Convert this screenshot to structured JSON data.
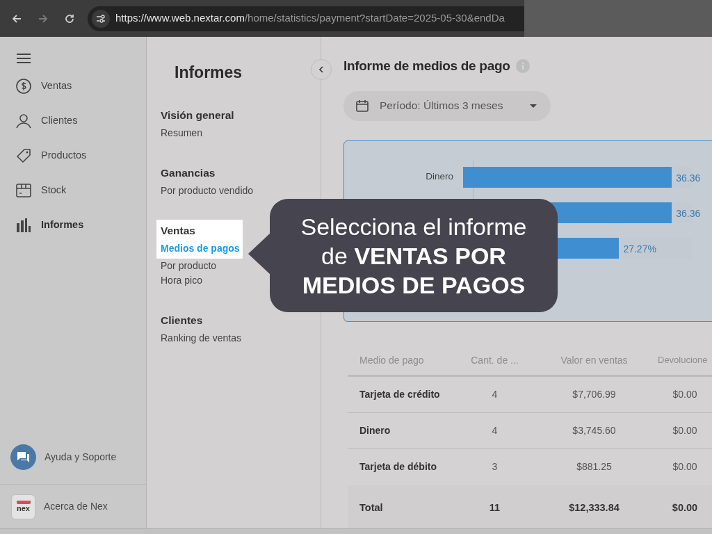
{
  "browser": {
    "url_host": "https://www.web.nextar.com",
    "url_path": "/home/statistics/payment?startDate=2025-05-30&endDa"
  },
  "sidebar": {
    "items": [
      {
        "kind": "dollar",
        "label": "Ventas",
        "selected": false
      },
      {
        "kind": "person",
        "label": "Clientes",
        "selected": false
      },
      {
        "kind": "tag",
        "label": "Productos",
        "selected": false
      },
      {
        "kind": "box",
        "label": "Stock",
        "selected": false
      },
      {
        "kind": "chart",
        "label": "Informes",
        "selected": true
      }
    ],
    "help": "Ayuda y Soporte",
    "about": "Acerca de Nex",
    "logo": "nex"
  },
  "reports_panel": {
    "title": "Informes",
    "sections": [
      {
        "heading": "Visión general",
        "highlighted": false,
        "items": [
          {
            "label": "Resumen",
            "selected": false
          }
        ]
      },
      {
        "heading": "Ganancias",
        "highlighted": false,
        "items": [
          {
            "label": "Por producto vendido",
            "selected": false
          }
        ]
      },
      {
        "heading": "Ventas",
        "highlighted": true,
        "items": [
          {
            "label": "Medios de pagos",
            "selected": true
          },
          {
            "label": "Por producto",
            "selected": false
          },
          {
            "label": "Hora pico",
            "selected": false
          }
        ]
      },
      {
        "heading": "Clientes",
        "highlighted": false,
        "items": [
          {
            "label": "Ranking de ventas",
            "selected": false
          }
        ]
      }
    ]
  },
  "main": {
    "title": "Informe de medios de pago",
    "period": "Período: Últimos 3 meses",
    "bars": [
      {
        "label": "Dinero",
        "level": 0.91,
        "value_label": "36.36"
      },
      {
        "level": 0.91,
        "value_label": "36.36"
      },
      {
        "level": 0.68,
        "value_label": "27.27%"
      }
    ],
    "table": {
      "columns": [
        "Medio de pago",
        "Cant. de ...",
        "Valor en ventas",
        "Devolucione"
      ],
      "rows": [
        [
          "Tarjeta de crédito",
          "4",
          "$7,706.99",
          "$0.00"
        ],
        [
          "Dinero",
          "4",
          "$3,745.60",
          "$0.00"
        ],
        [
          "Tarjeta de débito",
          "3",
          "$881.25",
          "$0.00"
        ]
      ],
      "total": [
        "Total",
        "11",
        "$12,333.84",
        "$0.00"
      ]
    }
  },
  "callout": {
    "text": "Selecciona el informe de **VENTAS POR MEDIOS DE PAGOS**"
  }
}
